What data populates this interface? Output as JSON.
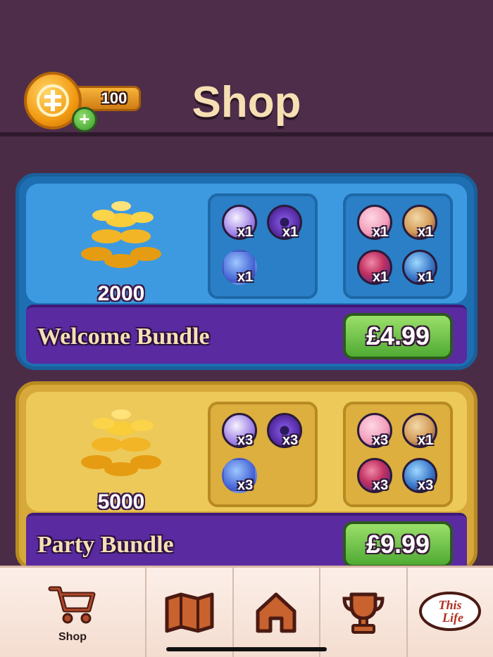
{
  "header": {
    "title": "Shop",
    "coin_balance": "100",
    "add_coins_symbol": "+"
  },
  "bundles": [
    {
      "name": "Welcome Bundle",
      "coins": "2000",
      "price": "£4.99",
      "theme": "blue",
      "items_box1": [
        {
          "icon": "disco-ball-icon",
          "qty": "x1"
        },
        {
          "icon": "speaker-icon",
          "qty": "x1"
        },
        {
          "icon": "microphone-icon",
          "qty": "x1"
        }
      ],
      "items_box2": [
        {
          "icon": "dice-icon",
          "qty": "x1"
        },
        {
          "icon": "glove-icon",
          "qty": "x1"
        },
        {
          "icon": "rocket-icon",
          "qty": "x1"
        },
        {
          "icon": "camera-icon",
          "qty": "x1"
        }
      ]
    },
    {
      "name": "Party Bundle",
      "coins": "5000",
      "price": "£9.99",
      "theme": "gold",
      "items_box1": [
        {
          "icon": "disco-ball-icon",
          "qty": "x3"
        },
        {
          "icon": "speaker-icon",
          "qty": "x3"
        },
        {
          "icon": "microphone-icon",
          "qty": "x3"
        }
      ],
      "items_box2": [
        {
          "icon": "dice-icon",
          "qty": "x3"
        },
        {
          "icon": "glove-icon",
          "qty": "x1"
        },
        {
          "icon": "rocket-icon",
          "qty": "x3"
        },
        {
          "icon": "camera-icon",
          "qty": "x3"
        }
      ]
    }
  ],
  "nav": {
    "shop_label": "Shop",
    "this_life_logo_text": "This Life",
    "items": [
      "shop-cart-icon",
      "map-icon",
      "home-icon",
      "trophy-icon",
      "this-life-logo"
    ]
  },
  "colors": {
    "background": "#4a2c47",
    "title": "#f6dfb3",
    "blue_card": "#1d6fb2",
    "gold_card": "#d6a93a",
    "bundle_bar": "#5a2aa0",
    "price_button": "#6cc648"
  }
}
